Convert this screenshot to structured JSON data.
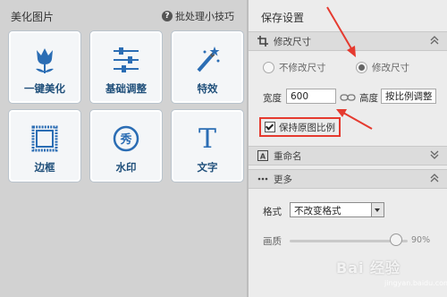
{
  "left_panel": {
    "title": "美化图片",
    "tips_label": "批处理小技巧",
    "tiles": [
      {
        "label": "一键美化",
        "icon": "tulip-icon"
      },
      {
        "label": "基础调整",
        "icon": "sliders-icon"
      },
      {
        "label": "特效",
        "icon": "magic-wand-icon"
      },
      {
        "label": "边框",
        "icon": "frame-icon"
      },
      {
        "label": "水印",
        "icon": "stamp-icon"
      },
      {
        "label": "文字",
        "icon": "text-icon"
      }
    ]
  },
  "right_panel": {
    "title": "保存设置",
    "resize_section": {
      "label": "修改尺寸",
      "option_keep": "不修改尺寸",
      "option_modify": "修改尺寸",
      "width_label": "宽度",
      "width_value": "600",
      "height_label": "高度",
      "height_placeholder": "按比例调整",
      "keep_ratio_label": "保持原图比例"
    },
    "rename_section": {
      "label": "重命名"
    },
    "more_section": {
      "label": "更多",
      "format_label": "格式",
      "format_value": "不改变格式",
      "quality_label": "画质",
      "quality_value": "90%",
      "quality_level": 0.9
    }
  },
  "watermark": {
    "text": "Bai 经验",
    "sub": "jingyan.baidu.com"
  },
  "colors": {
    "accent": "#e53a2f",
    "tile_text": "#1f4f7a",
    "icon_blue": "#2b6db4"
  }
}
